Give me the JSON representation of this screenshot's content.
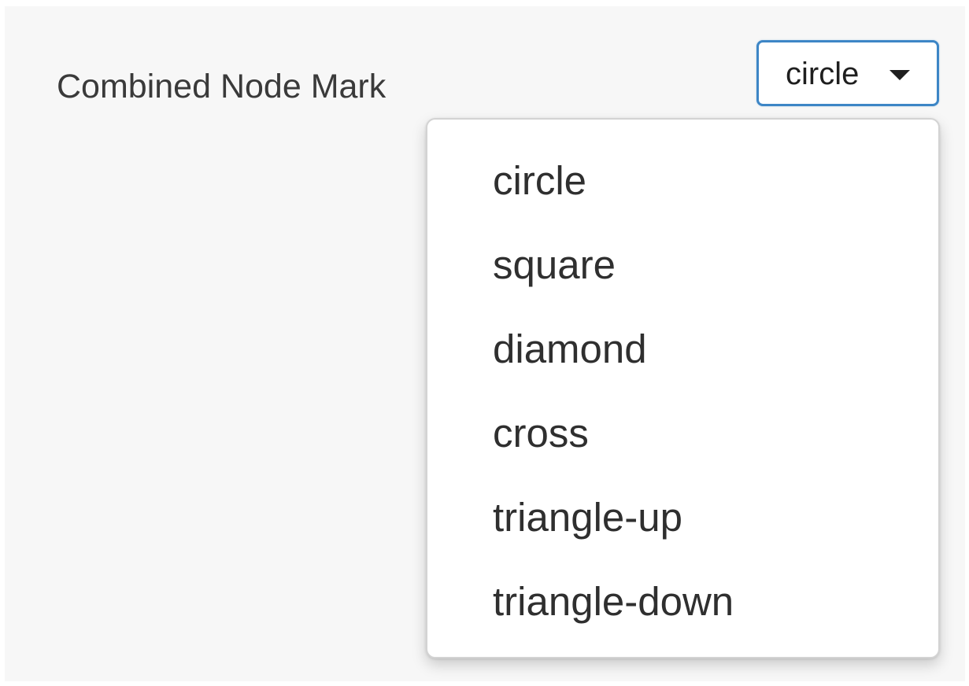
{
  "field": {
    "label": "Combined Node Mark"
  },
  "select": {
    "value": "circle",
    "caret_icon": "caret-down-icon",
    "accent_color": "#3d86c6"
  },
  "menu": {
    "options": [
      "circle",
      "square",
      "diamond",
      "cross",
      "triangle-up",
      "triangle-down"
    ]
  }
}
